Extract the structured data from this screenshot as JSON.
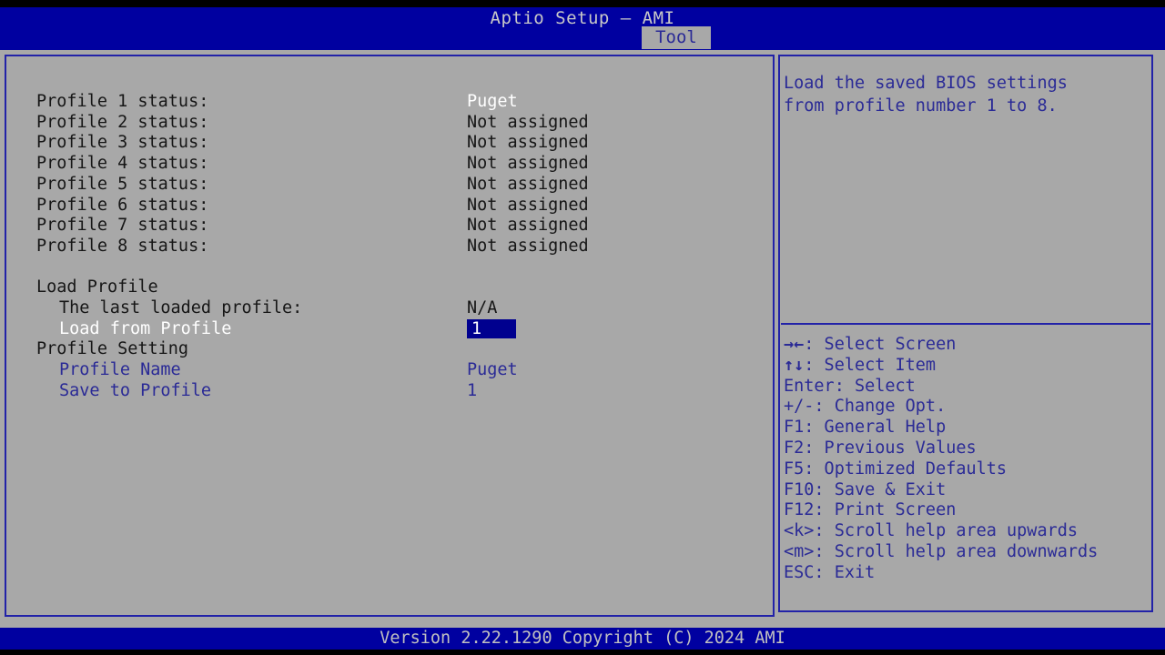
{
  "header": {
    "title": "Aptio Setup – AMI",
    "tabs": [
      {
        "label": "Tool",
        "active": true
      }
    ]
  },
  "colors": {
    "header_blue": "#0000a0",
    "panel_gray": "#a8a8a8",
    "border_blue": "#2222a8",
    "text_dark": "#161616",
    "text_blue": "#2a2a96",
    "text_white": "#ffffff",
    "highlight_bg": "#00008f",
    "footer_text": "#c0c0c0"
  },
  "main": {
    "profile_status": [
      {
        "label": "Profile 1 status:",
        "value": "Puget",
        "value_color": "white"
      },
      {
        "label": "Profile 2 status:",
        "value": "Not assigned",
        "value_color": "dark"
      },
      {
        "label": "Profile 3 status:",
        "value": "Not assigned",
        "value_color": "dark"
      },
      {
        "label": "Profile 4 status:",
        "value": "Not assigned",
        "value_color": "dark"
      },
      {
        "label": "Profile 5 status:",
        "value": "Not assigned",
        "value_color": "dark"
      },
      {
        "label": "Profile 6 status:",
        "value": "Not assigned",
        "value_color": "dark"
      },
      {
        "label": "Profile 7 status:",
        "value": "Not assigned",
        "value_color": "dark"
      },
      {
        "label": "Profile 8 status:",
        "value": "Not assigned",
        "value_color": "dark"
      }
    ],
    "load_profile": {
      "section_label": "Load Profile",
      "last_loaded_label": "The last loaded profile:",
      "last_loaded_value": "N/A",
      "load_from_label": "Load from Profile",
      "load_from_value": "1"
    },
    "profile_setting": {
      "section_label": "Profile Setting",
      "profile_name_label": "Profile Name",
      "profile_name_value": "Puget",
      "save_to_label": "Save to Profile",
      "save_to_value": "1"
    }
  },
  "help": {
    "lines": [
      "Load the saved BIOS settings",
      "from profile number 1 to 8."
    ],
    "legend": [
      {
        "key": "→←",
        "text": ": Select Screen"
      },
      {
        "key": "↑↓",
        "text": ": Select Item"
      },
      {
        "key": "",
        "text": "Enter: Select"
      },
      {
        "key": "",
        "text": "+/-: Change Opt."
      },
      {
        "key": "",
        "text": "F1: General Help"
      },
      {
        "key": "",
        "text": "F2: Previous Values"
      },
      {
        "key": "",
        "text": "F5: Optimized Defaults"
      },
      {
        "key": "",
        "text": "F10: Save & Exit"
      },
      {
        "key": "",
        "text": "F12: Print Screen"
      },
      {
        "key": "",
        "text": "<k>: Scroll help area upwards"
      },
      {
        "key": "",
        "text": "<m>: Scroll help area downwards"
      },
      {
        "key": "",
        "text": "ESC: Exit"
      }
    ]
  },
  "footer": {
    "version_text": "Version 2.22.1290 Copyright (C) 2024 AMI"
  }
}
